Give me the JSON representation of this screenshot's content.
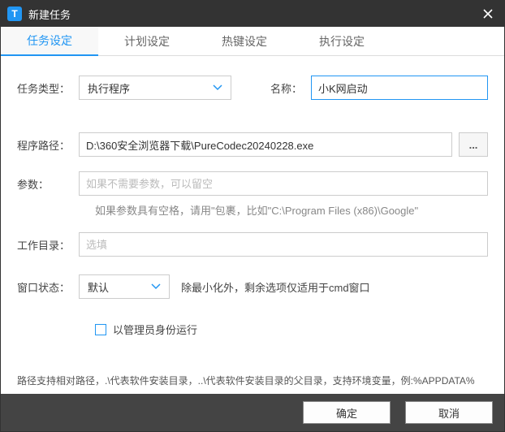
{
  "window": {
    "title": "新建任务"
  },
  "tabs": {
    "items": [
      {
        "label": "任务设定"
      },
      {
        "label": "计划设定"
      },
      {
        "label": "热键设定"
      },
      {
        "label": "执行设定"
      }
    ]
  },
  "form": {
    "type_label": "任务类型：",
    "type_value": "执行程序",
    "name_label": "名称：",
    "name_value": "小K网启动",
    "path_label": "程序路径：",
    "path_value": "D:\\360安全浏览器下载\\PureCodec20240228.exe",
    "browse_label": "...",
    "args_label": "参数：",
    "args_placeholder": "如果不需要参数，可以留空",
    "args_hint": "如果参数具有空格，请用\"包裹，比如\"C:\\Program Files (x86)\\Google\"",
    "workdir_label": "工作目录：",
    "workdir_placeholder": "选填",
    "window_label": "窗口状态：",
    "window_value": "默认",
    "window_note": "除最小化外，剩余选项仅适用于cmd窗口",
    "admin_label": "以管理员身份运行",
    "bottom_hint": "路径支持相对路径，.\\代表软件安装目录，..\\代表软件安装目录的父目录，支持环境变量，例:%APPDATA%"
  },
  "footer": {
    "ok": "确定",
    "cancel": "取消"
  }
}
